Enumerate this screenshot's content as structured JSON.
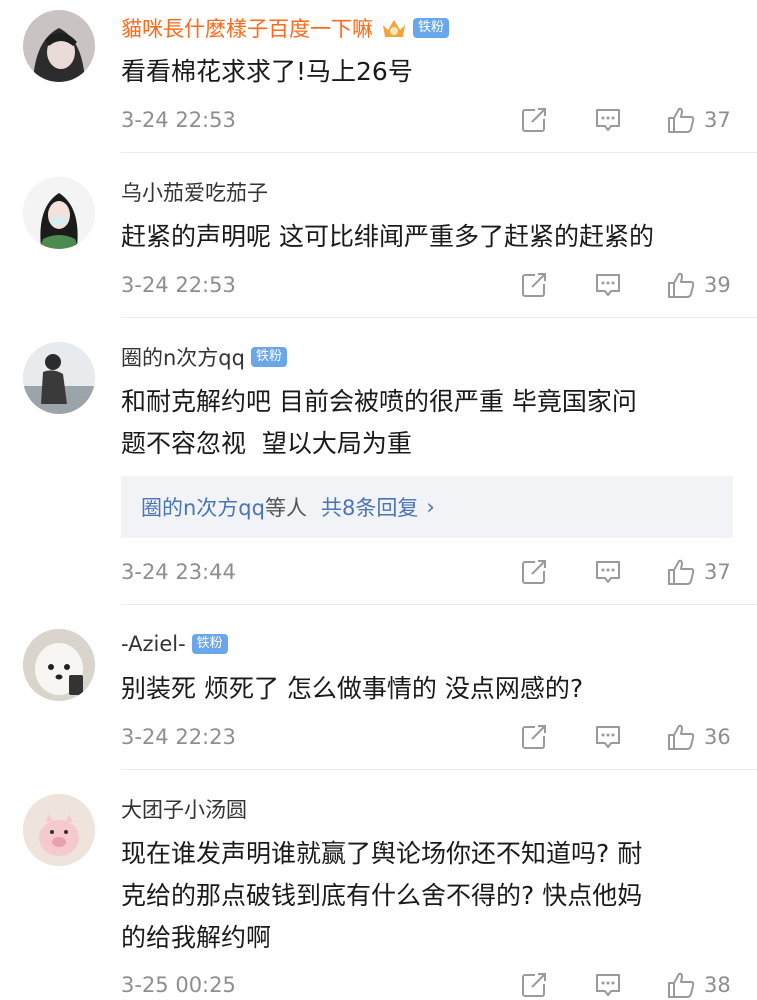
{
  "comments": [
    {
      "user": "貓咪長什麼樣子百度一下嘛",
      "badge": "铁粉",
      "text": "看看棉花求求了!马上26号",
      "time": "3-24 22:53",
      "likes": "37"
    },
    {
      "user": "乌小茄爱吃茄子",
      "text": "赶紧的声明呢 这可比绯闻严重多了赶紧的赶紧的",
      "time": "3-24 22:53",
      "likes": "39"
    },
    {
      "user": "圈的n次方qq",
      "badge": "铁粉",
      "text_line1": "和耐克解约吧 目前会被喷的很严重 毕竟国家问",
      "text_line2": "题不容忽视  望以大局为重",
      "replies": {
        "users": "圈的n次方qq",
        "mid": "等人",
        "count": "共8条回复",
        "chevron": "›"
      },
      "time": "3-24 23:44",
      "likes": "37"
    },
    {
      "user": "-Aziel-",
      "badge": "铁粉",
      "text": "别装死 烦死了 怎么做事情的 没点网感的?",
      "time": "3-24 22:23",
      "likes": "36"
    },
    {
      "user": "大团子小汤圆",
      "text_line1": "现在谁发声明谁就赢了舆论场你还不知道吗? 耐",
      "text_line2": "克给的那点破钱到底有什么舍不得的? 快点他妈",
      "text_line3": "的给我解约啊",
      "time": "3-25 00:25",
      "likes": "38"
    }
  ],
  "colors": {
    "vip_name": "#ff6a1a",
    "badge_bg": "#6aa6ea",
    "link": "#4a74b8",
    "meta": "#8e8e8e"
  },
  "icons": [
    "share-icon",
    "comment-icon",
    "thumbs-up-icon",
    "crown-icon"
  ]
}
